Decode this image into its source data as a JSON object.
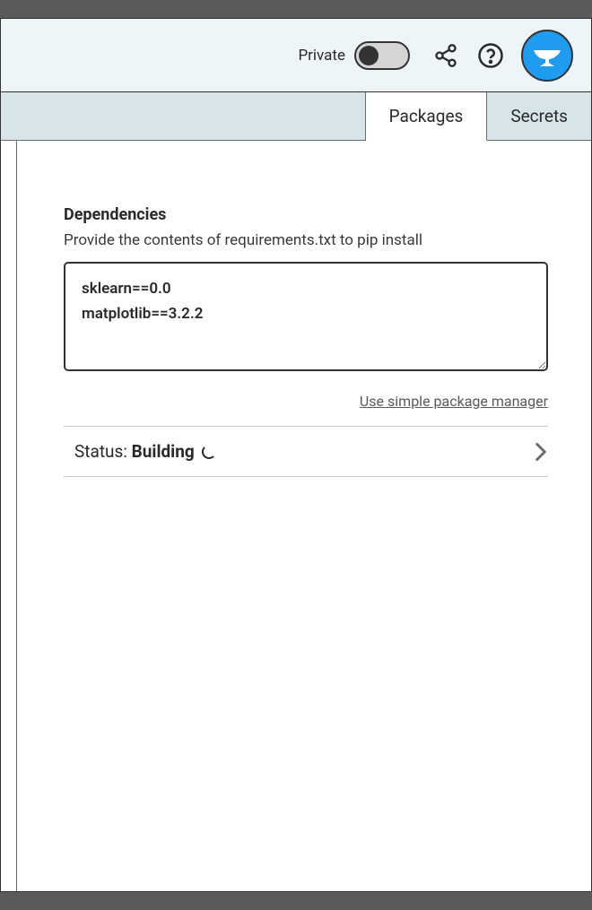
{
  "header": {
    "privacy_label": "Private",
    "toggle_on": false
  },
  "tabs": {
    "packages_label": "Packages",
    "secrets_label": "Secrets",
    "active": "packages"
  },
  "dependencies": {
    "title": "Dependencies",
    "subtitle": "Provide the contents of requirements.txt to pip install",
    "content": "sklearn==0.0\nmatplotlib==3.2.2",
    "simple_manager_link": "Use simple package manager"
  },
  "status": {
    "label": "Status: ",
    "value": "Building"
  }
}
